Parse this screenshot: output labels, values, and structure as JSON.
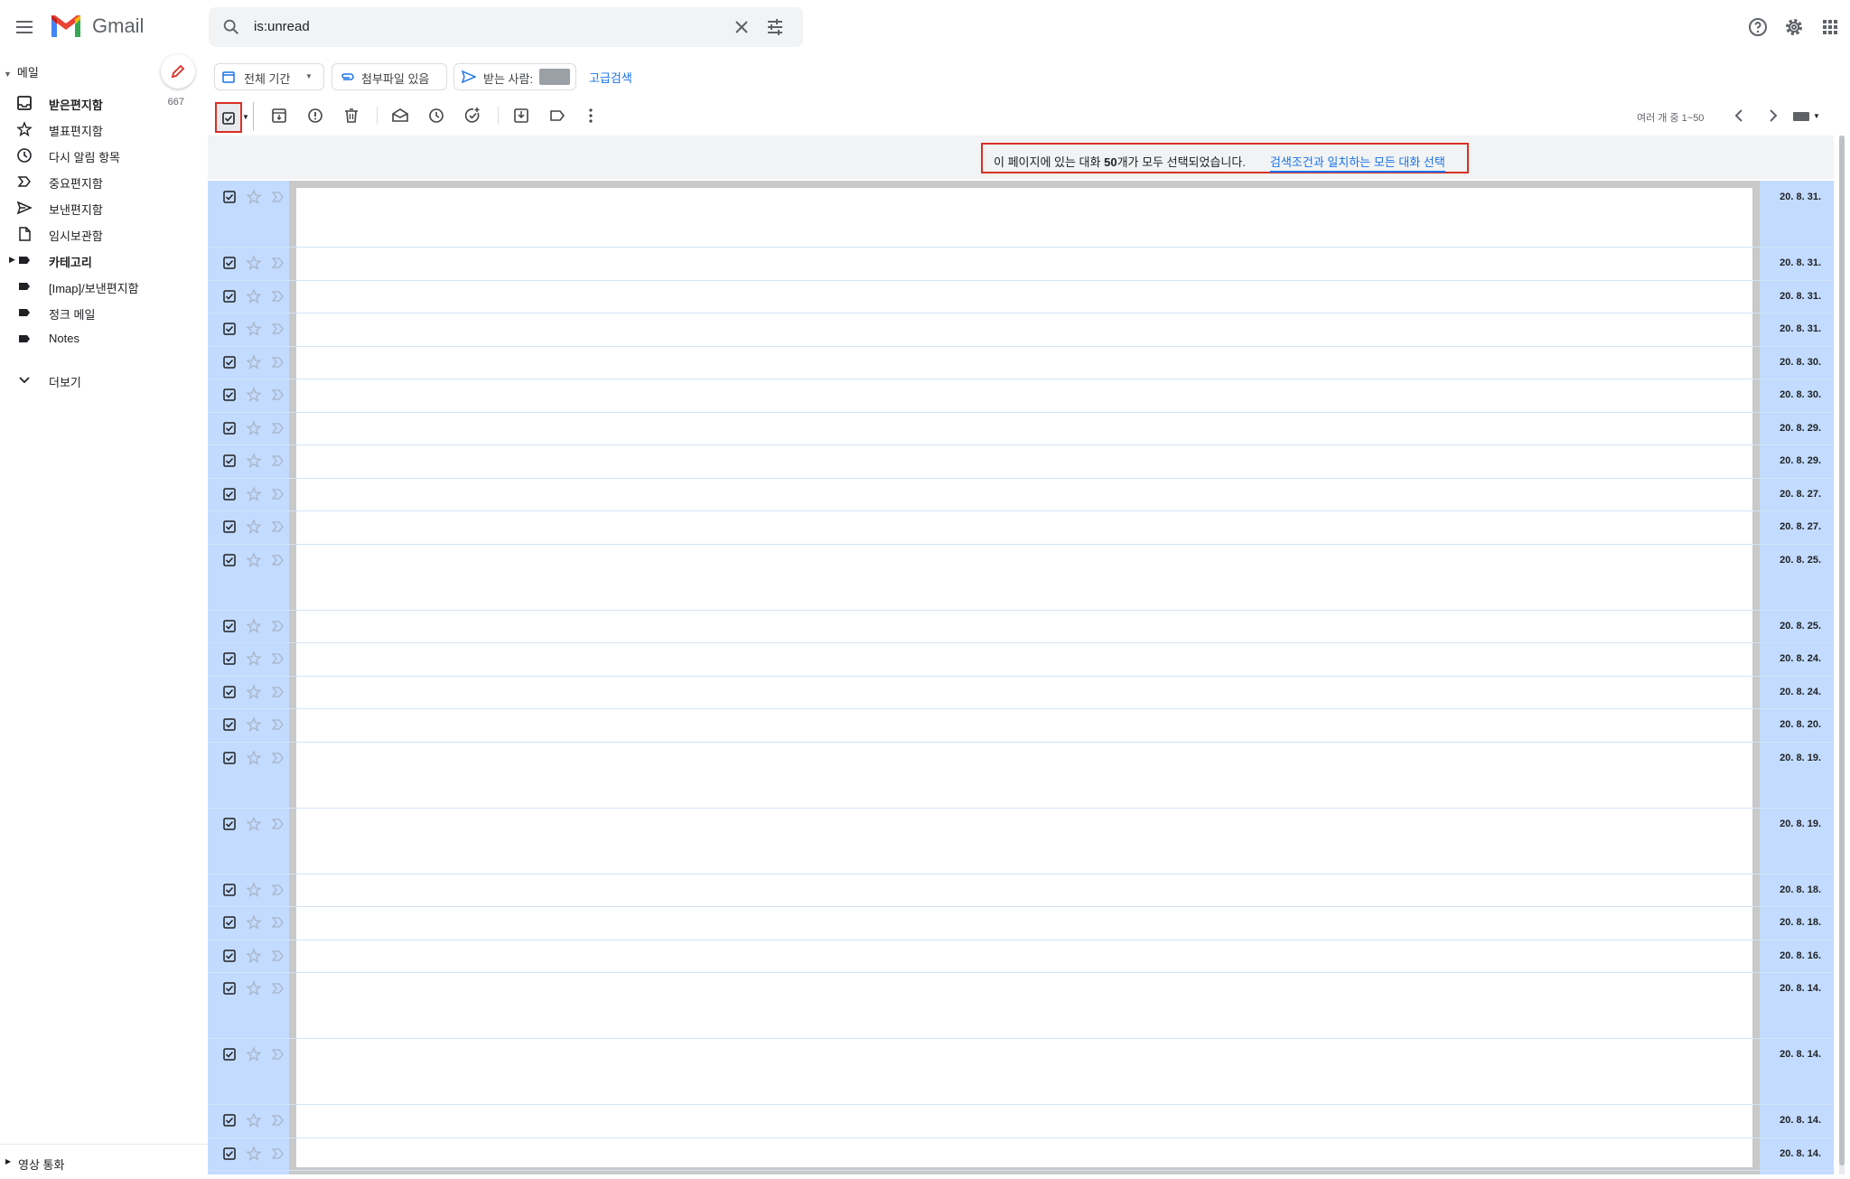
{
  "app": {
    "brand": "Gmail",
    "search_value": "is:unread"
  },
  "sidebar": {
    "section_label": "메일",
    "items": [
      {
        "label": "받은편지함",
        "count": "667",
        "icon": "inbox-icon",
        "bold": true
      },
      {
        "label": "별표편지함",
        "count": "",
        "icon": "star-icon",
        "bold": false
      },
      {
        "label": "다시 알림 항목",
        "count": "",
        "icon": "clock-icon",
        "bold": false
      },
      {
        "label": "중요편지함",
        "count": "",
        "icon": "important-icon",
        "bold": false
      },
      {
        "label": "보낸편지함",
        "count": "",
        "icon": "send-icon",
        "bold": false
      },
      {
        "label": "임시보관함",
        "count": "",
        "icon": "draft-icon",
        "bold": false
      },
      {
        "label": "카테고리",
        "count": "",
        "icon": "label-icon",
        "bold": true
      },
      {
        "label": "[Imap]/보낸편지함",
        "count": "",
        "icon": "label-icon",
        "bold": false
      },
      {
        "label": "정크 메일",
        "count": "",
        "icon": "label-icon",
        "bold": false
      },
      {
        "label": "Notes",
        "count": "",
        "icon": "label-icon",
        "bold": false
      }
    ],
    "more_label": "더보기",
    "video_call_label": "영상 통화"
  },
  "filters": {
    "date_chip": "전체 기간",
    "attachment_chip": "첨부파일 있음",
    "to_chip": "받는 사람:",
    "advanced_link": "고급검색"
  },
  "toolbar": {
    "pager_text": "여러 개 중 1~50"
  },
  "banner": {
    "prefix": "이 페이지에 있는 대화 ",
    "count": "50",
    "suffix": "개가 모두 선택되었습니다.",
    "link": "검색조건과 일치하는 모든 대화 선택"
  },
  "rows": [
    {
      "date": "20. 8. 31.",
      "tall": true
    },
    {
      "date": "20. 8. 31.",
      "tall": false
    },
    {
      "date": "20. 8. 31.",
      "tall": false
    },
    {
      "date": "20. 8. 31.",
      "tall": false
    },
    {
      "date": "20. 8. 30.",
      "tall": false
    },
    {
      "date": "20. 8. 30.",
      "tall": false
    },
    {
      "date": "20. 8. 29.",
      "tall": false
    },
    {
      "date": "20. 8. 29.",
      "tall": false
    },
    {
      "date": "20. 8. 27.",
      "tall": false
    },
    {
      "date": "20. 8. 27.",
      "tall": false
    },
    {
      "date": "20. 8. 25.",
      "tall": true
    },
    {
      "date": "20. 8. 25.",
      "tall": false
    },
    {
      "date": "20. 8. 24.",
      "tall": false
    },
    {
      "date": "20. 8. 24.",
      "tall": false
    },
    {
      "date": "20. 8. 20.",
      "tall": false
    },
    {
      "date": "20. 8. 19.",
      "tall": true
    },
    {
      "date": "20. 8. 19.",
      "tall": true
    },
    {
      "date": "20. 8. 18.",
      "tall": false
    },
    {
      "date": "20. 8. 18.",
      "tall": false
    },
    {
      "date": "20. 8. 16.",
      "tall": false
    },
    {
      "date": "20. 8. 14.",
      "tall": true
    },
    {
      "date": "20. 8. 14.",
      "tall": true
    },
    {
      "date": "20. 8. 14.",
      "tall": false
    },
    {
      "date": "20. 8. 14.",
      "tall": false
    }
  ],
  "colors": {
    "selected_row": "#c2dbff",
    "accent_red": "#d93025",
    "link_blue": "#1a73e8"
  }
}
